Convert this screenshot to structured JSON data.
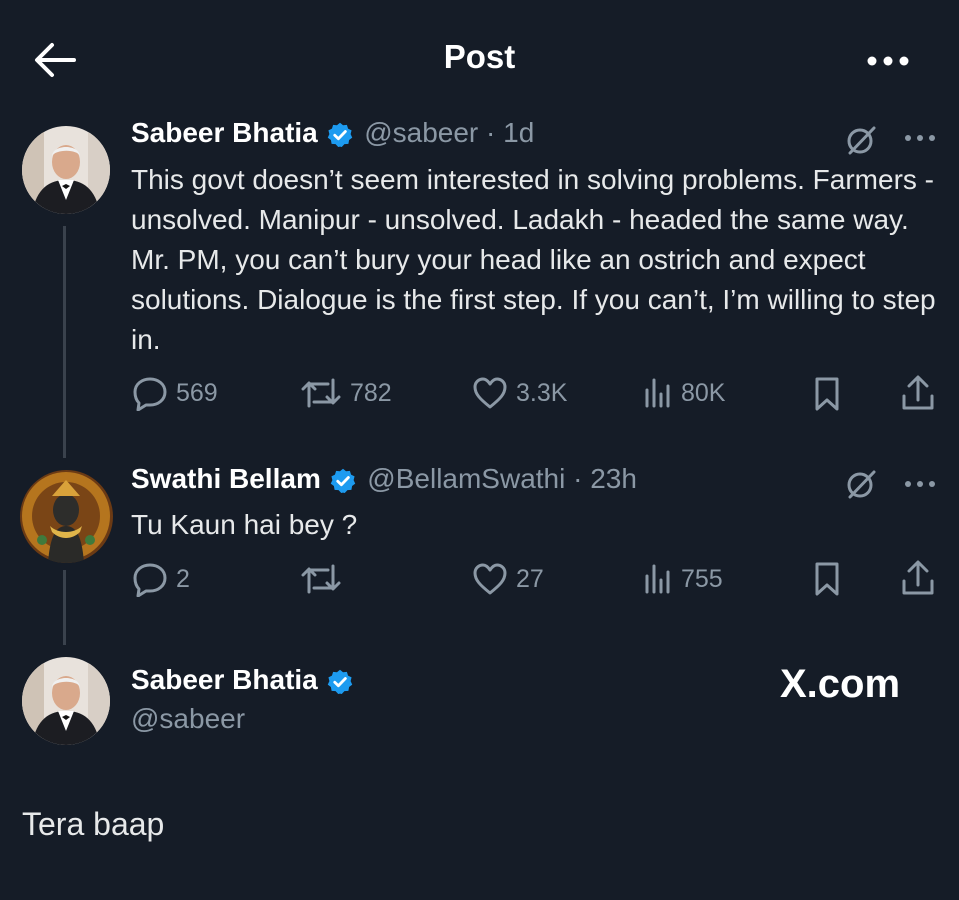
{
  "header": {
    "title": "Post"
  },
  "tweets": [
    {
      "name": "Sabeer Bhatia",
      "handle_meta": "@sabeer · 1d",
      "text": "This govt doesn’t seem interested in solving problems. Farmers - unsolved. Manipur - unsolved. Ladakh - headed the same way. Mr. PM, you can’t bury your head like an ostrich and expect solutions. Dialogue is the first step. If you can’t, I’m willing to step in.",
      "replies": "569",
      "reposts": "782",
      "likes": "3.3K",
      "views": "80K"
    },
    {
      "name": "Swathi Bellam",
      "handle_meta": "@BellamSwathi · 23h",
      "text": "Tu Kaun hai bey ?",
      "replies": "2",
      "reposts": "",
      "likes": "27",
      "views": "755"
    }
  ],
  "reply": {
    "name": "Sabeer Bhatia",
    "handle": "@sabeer",
    "text": "Tera baap"
  },
  "watermark": "X.com",
  "colors": {
    "background": "#151c27",
    "verified": "#1d9bf0",
    "muted": "#8b98a5",
    "text": "#e7e9ea"
  }
}
